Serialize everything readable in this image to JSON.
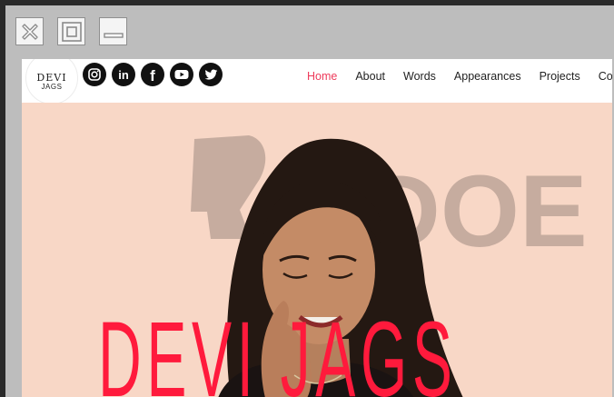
{
  "window_controls": {
    "close": "close",
    "maximize": "maximize",
    "minimize": "minimize"
  },
  "site": {
    "logo": {
      "line1": "DEVI",
      "line2": "JAGS"
    },
    "socials": [
      {
        "name": "instagram-icon"
      },
      {
        "name": "linkedin-icon",
        "glyph": "in"
      },
      {
        "name": "facebook-icon",
        "glyph": "f"
      },
      {
        "name": "youtube-icon"
      },
      {
        "name": "twitter-icon"
      }
    ],
    "nav": [
      {
        "label": "Home",
        "active": true
      },
      {
        "label": "About"
      },
      {
        "label": "Words"
      },
      {
        "label": "Appearances"
      },
      {
        "label": "Projects"
      },
      {
        "label": "Contact"
      }
    ],
    "hero": {
      "title": "DEVI JAGS",
      "watermark": "DOE",
      "bg_color": "#f8d7c6",
      "title_color": "#ff1a3c"
    },
    "accent": "#ee3b5b"
  }
}
